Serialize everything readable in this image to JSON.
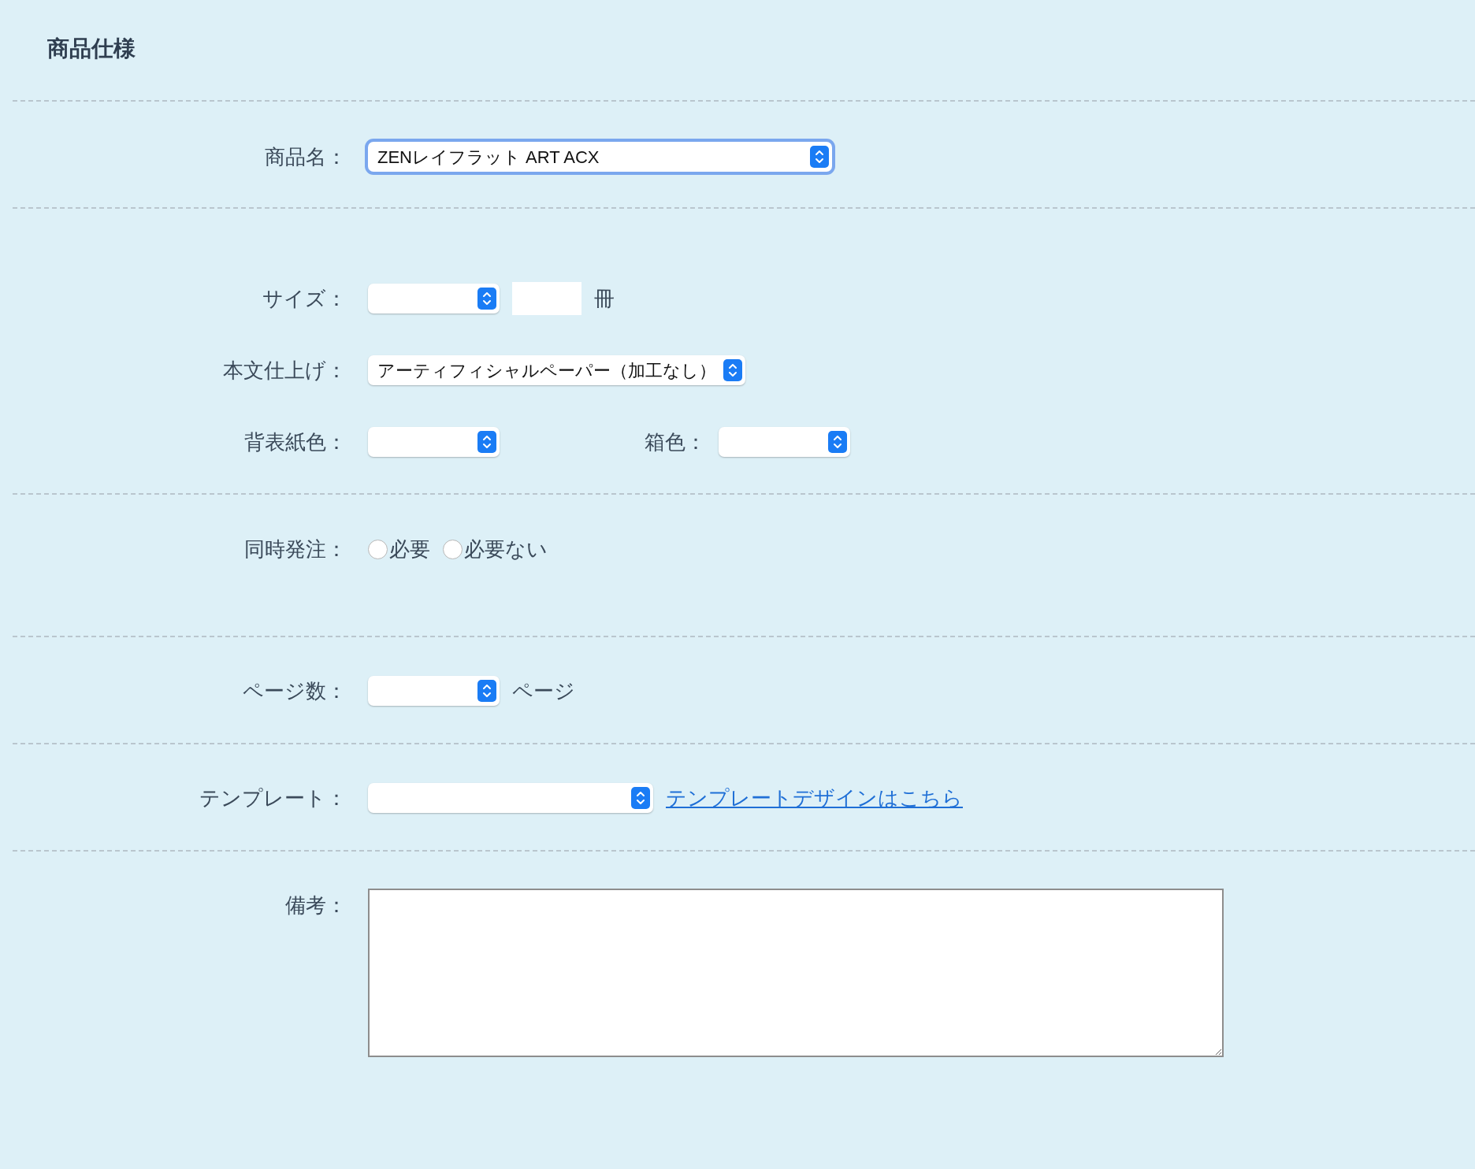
{
  "title": "商品仕様",
  "sections": [
    {
      "rows": [
        {
          "label": "商品名：",
          "controls": [
            {
              "kind": "select",
              "value": "ZENレイフラット ART ACX",
              "focused": true
            }
          ]
        }
      ]
    },
    {
      "rows": [
        {
          "label": "サイズ：",
          "controls": [
            {
              "kind": "select",
              "focused": false
            },
            {
              "kind": "input"
            },
            {
              "kind": "text",
              "text": "冊"
            }
          ]
        },
        {
          "label": "本文仕上げ：",
          "controls": [
            {
              "kind": "select",
              "value": "アーティフィシャルペーパー（加工なし）",
              "focused": false
            }
          ]
        },
        {
          "label": "背表紙色：",
          "controls": [
            {
              "kind": "select",
              "focused": false
            },
            {
              "kind": "label",
              "text": "箱色："
            },
            {
              "kind": "select",
              "focused": false
            }
          ]
        }
      ]
    },
    {
      "rows": [
        {
          "label": "同時発注：",
          "controls": [
            {
              "kind": "radio",
              "text": "必要",
              "selected": false
            },
            {
              "kind": "radio",
              "text": "必要ない",
              "selected": false
            }
          ]
        }
      ]
    },
    {
      "rows": [
        {
          "label": "ページ数：",
          "controls": [
            {
              "kind": "select",
              "focused": false
            },
            {
              "kind": "text",
              "text": "ページ"
            }
          ]
        }
      ]
    },
    {
      "rows": [
        {
          "label": "テンプレート：",
          "controls": [
            {
              "kind": "select",
              "focused": false
            },
            {
              "kind": "link",
              "text": "テンプレートデザインはこちら"
            }
          ]
        }
      ]
    },
    {
      "rows": [
        {
          "label": "備考：",
          "controls": [
            {
              "kind": "textarea"
            }
          ]
        }
      ]
    }
  ]
}
